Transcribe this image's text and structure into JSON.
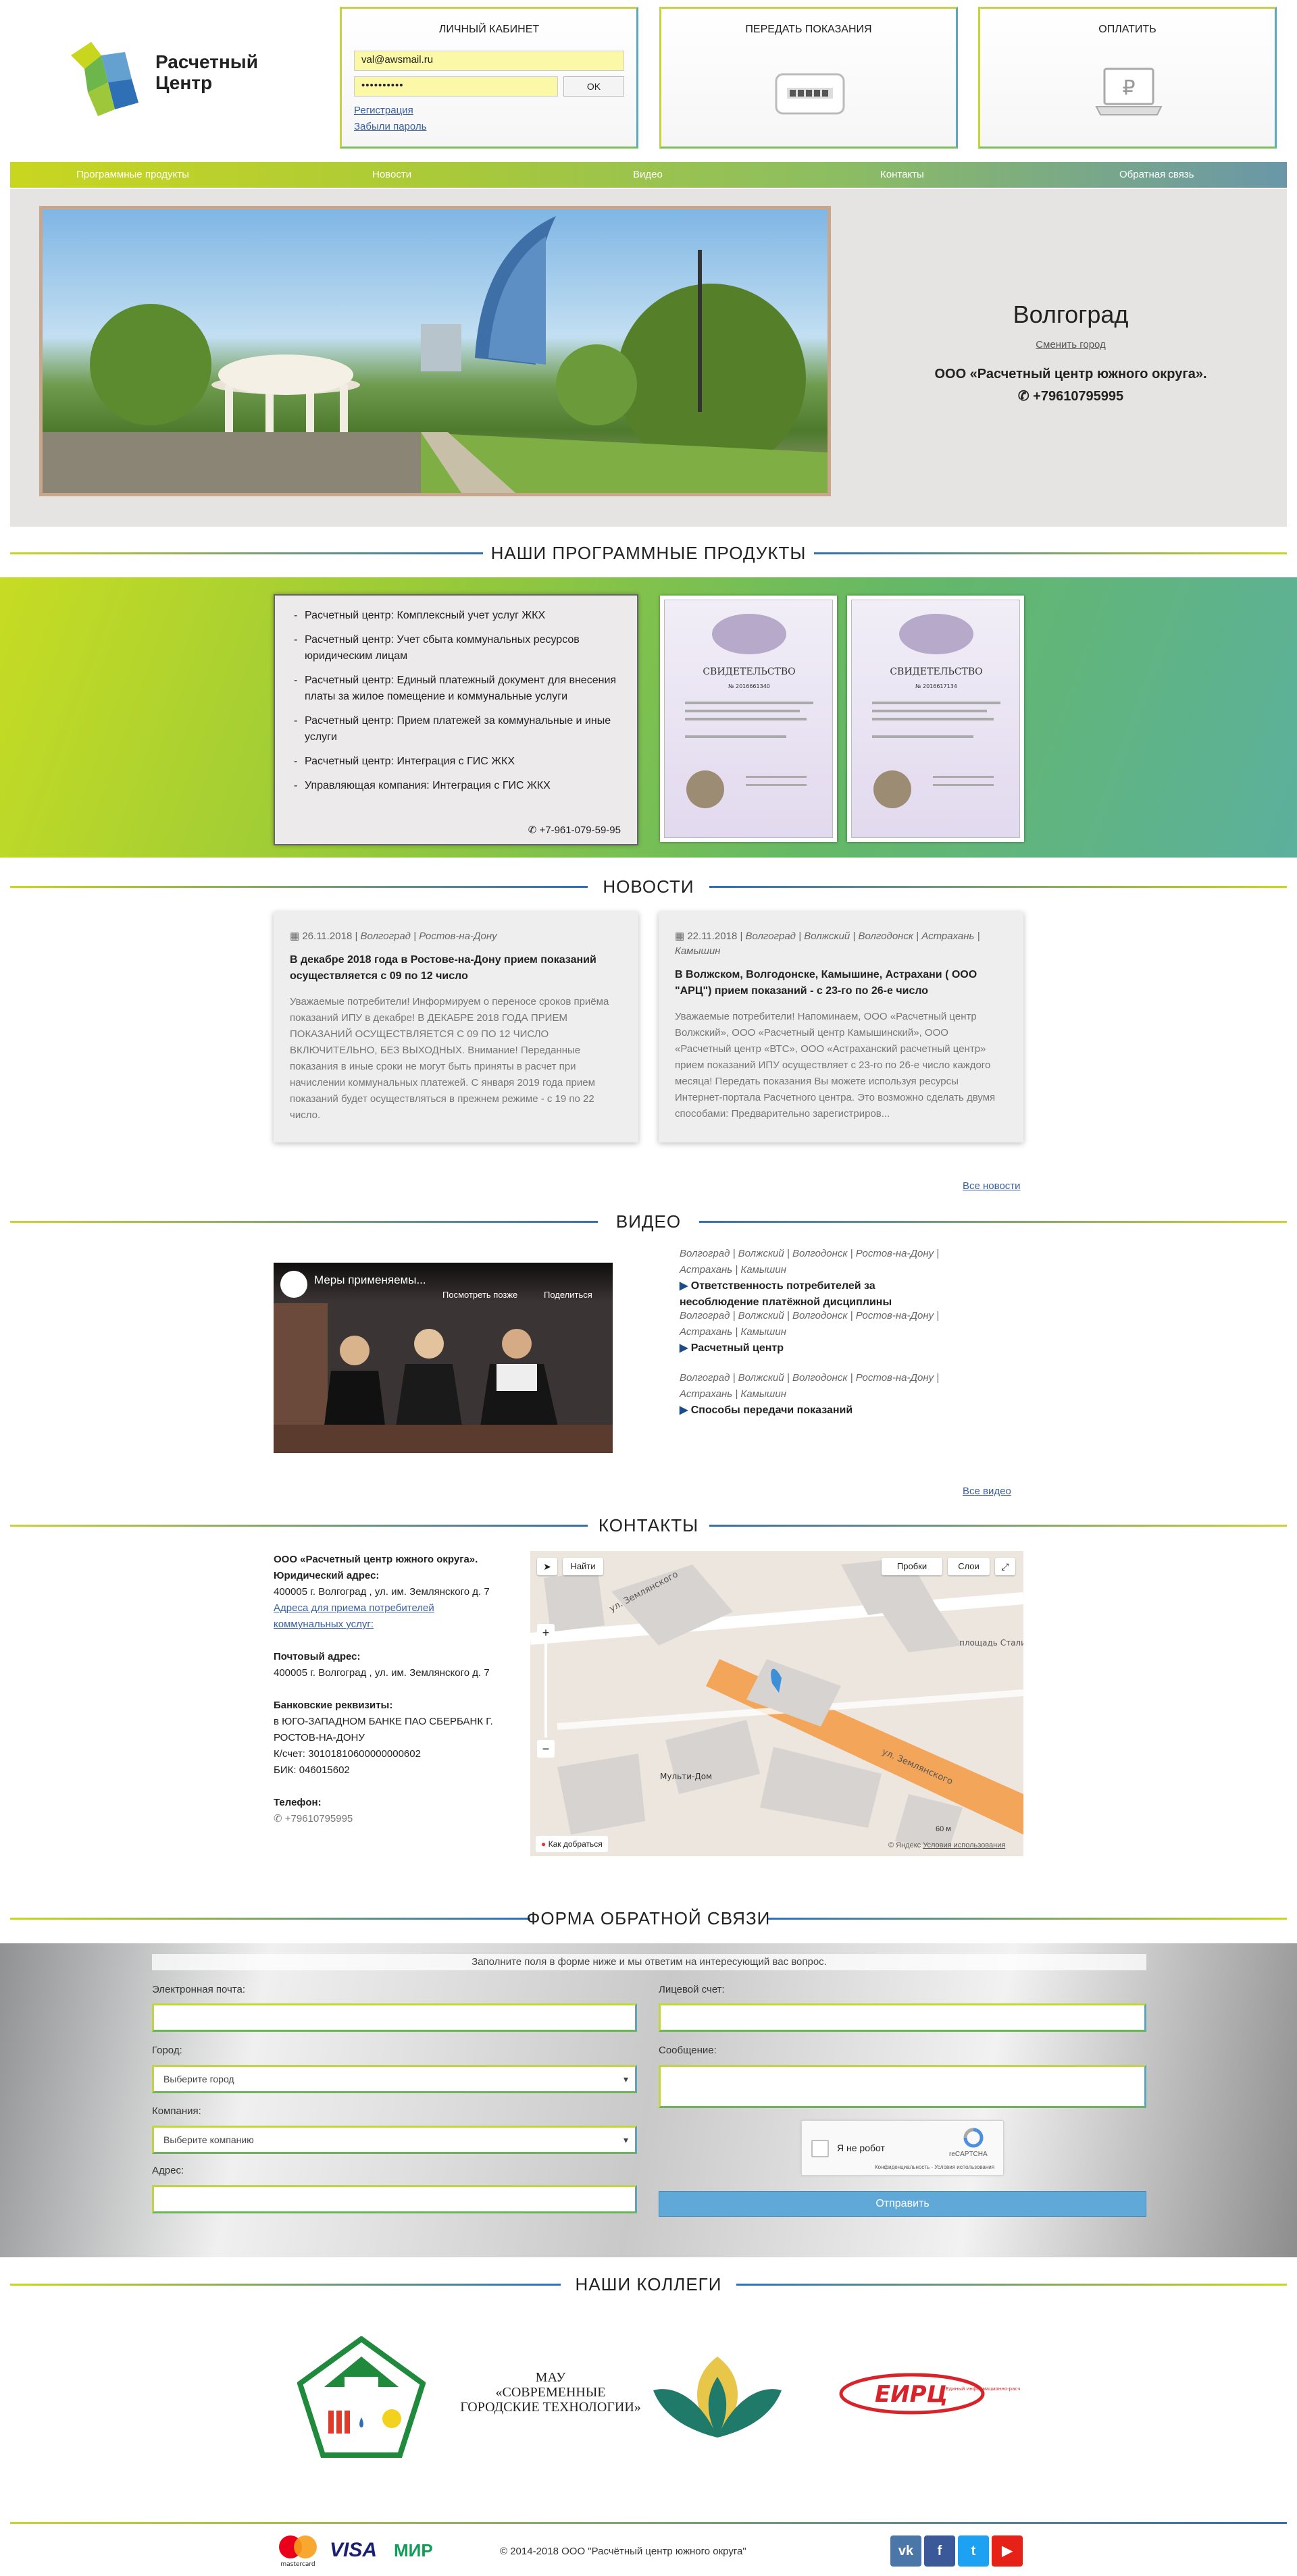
{
  "header": {
    "logo_text_line1": "Расчетный",
    "logo_text_line2": "Центр",
    "cabinet_title": "ЛИЧНЫЙ КАБИНЕТ",
    "email_value": "val@awsmail.ru",
    "password_value": "••••••••••",
    "ok_label": "OK",
    "register_link": "Регистрация",
    "forgot_link": "Забыли пароль",
    "readings_title": "ПЕРЕДАТЬ ПОКАЗАНИЯ",
    "pay_title": "ОПЛАТИТЬ"
  },
  "menu": {
    "items": [
      "Программные продукты",
      "Новости",
      "Видео",
      "Контакты",
      "Обратная связь"
    ]
  },
  "hero": {
    "city": "Волгоград",
    "change_city": "Сменить город",
    "company": "ООО «Расчетный центр южного округа».",
    "phone": "+79610795995"
  },
  "products": {
    "title": "НАШИ ПРОГРАММНЫЕ ПРОДУКТЫ",
    "items": [
      "Расчетный центр: Комплексный учет услуг ЖКХ",
      "Расчетный центр: Учет сбыта коммунальных ресурсов юридическим лицам",
      "Расчетный центр: Единый платежный документ для внесения платы за жилое помещение и коммунальные услуги",
      "Расчетный центр: Прием платежей за коммунальные и иные услуги",
      "Расчетный центр: Интеграция с ГИС ЖКХ",
      "Управляющая компания: Интеграция с ГИС ЖКХ"
    ],
    "phone": "+7-961-079-59-95",
    "cert_heading": "СВИДЕТЕЛЬСТВО",
    "cert1_number": "№ 2016661340",
    "cert2_number": "№ 2016617134"
  },
  "news": {
    "title": "НОВОСТИ",
    "all_link": "Все новости",
    "items": [
      {
        "date": "26.11.2018",
        "tags": "Волгоград | Ростов-на-Дону",
        "title": "В декабре 2018 года в Ростове-на-Дону прием показаний осуществляется с 09 по 12 число",
        "text": "Уважаемые потребители! Информируем о переносе сроков приёма показаний ИПУ в декабре! В ДЕКАБРЕ 2018 ГОДА ПРИЕМ ПОКАЗАНИЙ ОСУЩЕСТВЛЯЕТСЯ С 09 ПО 12 ЧИСЛО ВКЛЮЧИТЕЛЬНО, БЕЗ ВЫХОДНЫХ. Внимание! Переданные показания в иные сроки не могут быть приняты в расчет при начислении коммунальных платежей. С января 2019 года прием показаний будет осуществляться в прежнем режиме - с 19 по 22 число."
      },
      {
        "date": "22.11.2018",
        "tags": "Волгоград | Волжский | Волгодонск | Астрахань | Камышин",
        "title": "В Волжском, Волгодонске, Камышине, Астрахани ( ООО \"АРЦ\") прием показаний - с 23-го по 26-е число",
        "text": "Уважаемые потребители! Напоминаем, ООО «Расчетный центр Волжский», ООО «Расчетный центр Камышинский», ООО «Расчетный центр «ВТС», ООО «Астраханский расчетный центр» прием показаний ИПУ осуществляет с 23-го по 26-е число каждого месяца! Передать показания Вы можете используя ресурсы Интернет-портала Расчетного центра. Это возможно сделать двумя способами: Предварительно зарегистриров..."
      }
    ]
  },
  "video": {
    "title": "ВИДЕО",
    "all_link": "Все видео",
    "thumb_title": "Меры применяемы...",
    "watch_later": "Посмотреть позже",
    "share": "Поделиться",
    "items": [
      {
        "tags": "Волгоград | Волжский | Волгодонск | Ростов-на-Дону | Астрахань | Камышин",
        "name": "Ответственность потребителей за несоблюдение платёжной дисциплины"
      },
      {
        "tags": "Волгоград | Волжский | Волгодонск | Ростов-на-Дону | Астрахань | Камышин",
        "name": "Расчетный центр"
      },
      {
        "tags": "Волгоград | Волжский | Волгодонск | Ростов-на-Дону | Астрахань | Камышин",
        "name": "Способы передачи показаний"
      }
    ]
  },
  "contacts": {
    "title": "КОНТАКТЫ",
    "company": "ООО «Расчетный центр южного округа».",
    "legal_label": "Юридический адрес:",
    "legal_address": "400005 г. Волгоград , ул. им. Землянского д. 7",
    "service_link": "Адреса для приема потребителей коммунальных услуг:",
    "postal_label": "Почтовый адрес:",
    "postal_address": "400005 г. Волгоград , ул. им. Землянского д. 7",
    "bank_label": "Банковские реквизиты:",
    "bank_line1": "в ЮГО-ЗАПАДНОМ БАНКЕ ПАО СБЕРБАНК Г. РОСТОВ-НА-ДОНУ",
    "bank_line2": "К/счет: 30101810600000000602",
    "bank_line3": "БИК: 046015602",
    "phone_label": "Телефон:",
    "phone": "+79610795995",
    "map_find": "Найти",
    "map_traffic": "Пробки",
    "map_layers": "Слои",
    "map_route": "Как добраться",
    "map_copyright": "© Яндекс",
    "map_terms": "Условия использования",
    "map_street1": "ул. Землянского",
    "map_street2": "ул. Землянского",
    "map_square": "площадь Сталинградской Победы",
    "map_place": "Мульти-Дом",
    "map_scale": "60 м"
  },
  "feedback": {
    "title": "ФОРМА ОБРАТНОЙ СВЯЗИ",
    "hint": "Заполните поля в форме ниже и мы ответим на интересующий вас вопрос.",
    "email_label": "Электронная почта:",
    "account_label": "Лицевой счет:",
    "city_label": "Город:",
    "city_placeholder": "Выберите город",
    "message_label": "Сообщение:",
    "company_label": "Компания:",
    "company_placeholder": "Выберите компанию",
    "address_label": "Адрес:",
    "captcha_label": "Я не робот",
    "captcha_brand": "reCAPTCHA",
    "captcha_terms": "Конфиденциальность - Условия использования",
    "send_label": "Отправить"
  },
  "colleagues": {
    "title": "НАШИ КОЛЛЕГИ",
    "mau_line1": "МАУ",
    "mau_line2": "«СОВРЕМЕННЫЕ ГОРОДСКИЕ ТЕХНОЛОГИИ»",
    "eirc": "ЕИРЦ",
    "eirc_sub": "Единый информационно-расчетный центр"
  },
  "footer": {
    "copyright": "© 2014-2018 ООО \"Расчётный центр южного округа\"",
    "mastercard": "mastercard",
    "visa": "VISA",
    "mir": "МИР",
    "vk": "vk",
    "fb": "f",
    "tw": "t",
    "yt": "▶"
  },
  "colors": {
    "accent_green": "#c9d620",
    "accent_blue": "#2f6fb5",
    "button_blue": "#5fa8d8"
  }
}
